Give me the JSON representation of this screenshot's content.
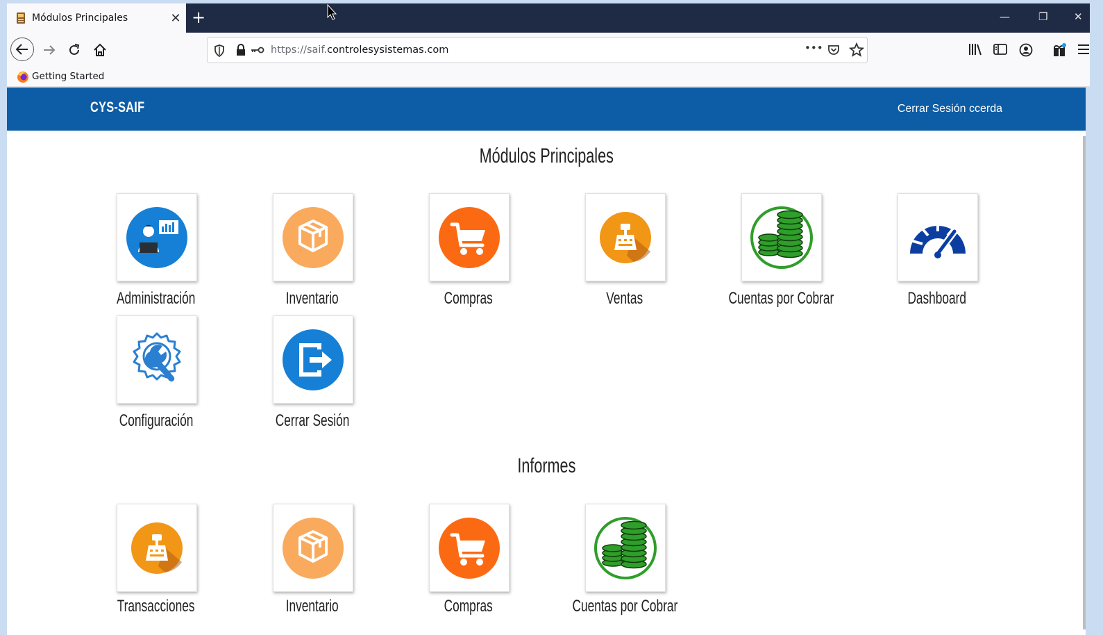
{
  "browser": {
    "tab_title": "Módulos Principales",
    "tab_close": "✕",
    "new_tab": "+",
    "url_prefix": "https://saif.",
    "url_domain": "controlesysistemas.com",
    "page_actions": "•••",
    "bookmark_label": "Getting Started",
    "window_minimize": "—",
    "window_restore": "❐",
    "window_close": "✕"
  },
  "header": {
    "brand": "CYS-SAIF",
    "logout_link": "Cerrar Sesión ccerda"
  },
  "sections": {
    "main": {
      "title": "Módulos Principales",
      "items": [
        {
          "label": "Administración",
          "icon": "administration-icon"
        },
        {
          "label": "Inventario",
          "icon": "inventory-box-icon"
        },
        {
          "label": "Compras",
          "icon": "shopping-cart-icon"
        },
        {
          "label": "Ventas",
          "icon": "cash-register-icon"
        },
        {
          "label": "Cuentas por Cobrar",
          "icon": "coins-stack-icon"
        },
        {
          "label": "Dashboard",
          "icon": "speedometer-icon"
        },
        {
          "label": "Configuración",
          "icon": "gear-wrench-icon"
        },
        {
          "label": "Cerrar Sesión",
          "icon": "logout-icon"
        }
      ]
    },
    "reports": {
      "title": "Informes",
      "items": [
        {
          "label": "Transacciones",
          "icon": "cash-register-icon"
        },
        {
          "label": "Inventario",
          "icon": "inventory-box-icon"
        },
        {
          "label": "Compras",
          "icon": "shopping-cart-icon"
        },
        {
          "label": "Cuentas por Cobrar",
          "icon": "coins-stack-icon"
        }
      ]
    }
  },
  "colors": {
    "header_bg": "#0d5ca6",
    "blue_icon": "#1580d6",
    "light_orange": "#f9aa5d",
    "orange": "#fb6a12",
    "amber": "#f29616",
    "green": "#2f9e2a",
    "navy": "#0c3ea1"
  }
}
